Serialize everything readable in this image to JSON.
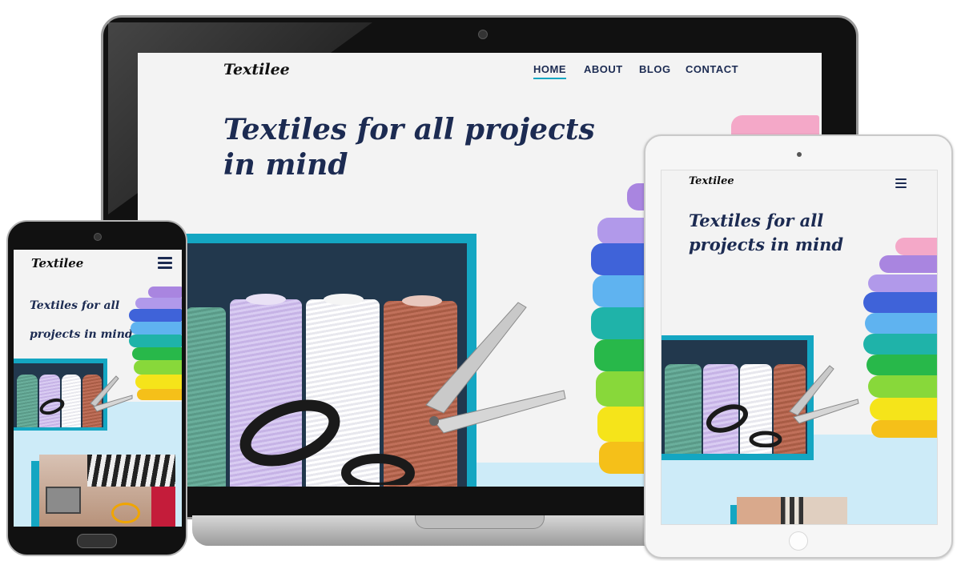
{
  "brand": "Textilee",
  "nav": {
    "home": "HOME",
    "about": "ABOUT",
    "blog": "BLOG",
    "contact": "CONTACT"
  },
  "hero": {
    "heading_line1": "Textiles for all projects",
    "heading_line2": "in mind",
    "tablet_line1": "Textiles for all",
    "tablet_line2": "projects in mind",
    "phone_line1": "Textiles for all",
    "phone_line2": "projects in mind"
  },
  "icons": {
    "menu": "hamburger-menu-icon",
    "camera": "camera-icon",
    "home_button": "home-button-icon"
  },
  "colors": {
    "accent": "#14a6c2",
    "navy": "#1c2b52",
    "panel": "#22384d",
    "light_blue": "#cdebf8",
    "page_bg": "#f3f3f3"
  }
}
